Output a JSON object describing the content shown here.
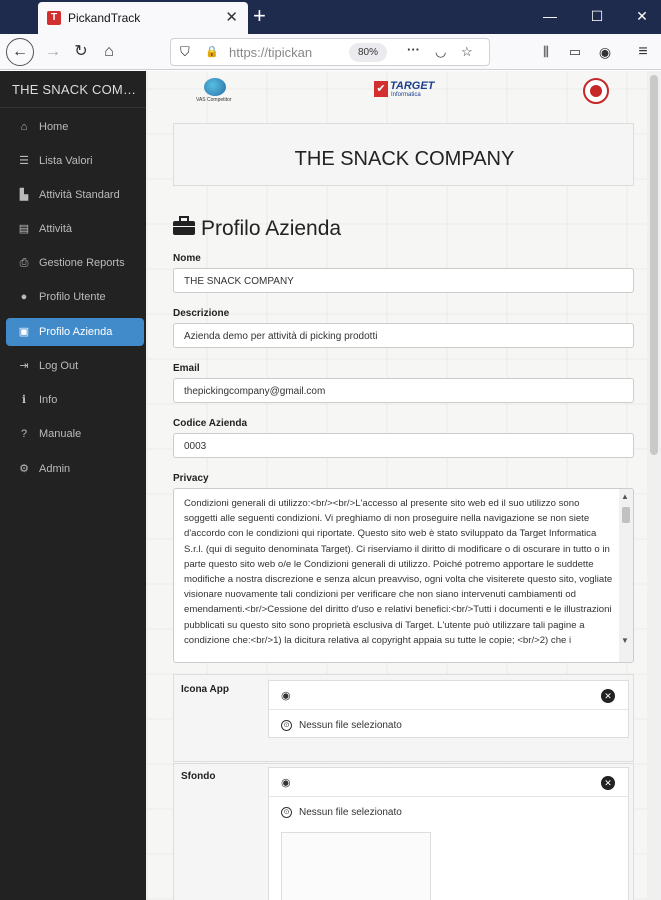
{
  "browser": {
    "tab_title": "PickandTrack",
    "tab_favicon": "T",
    "url": "https://tipickan",
    "zoom": "80%",
    "icons": [
      "back-icon",
      "forward-icon",
      "reload-icon",
      "home-icon",
      "shield-icon",
      "lock-icon",
      "more-icon",
      "pocket-icon",
      "star-icon",
      "library-icon",
      "sidebar-icon",
      "account-icon",
      "menu-icon"
    ]
  },
  "sidebar": {
    "brand": "THE SNACK COMPANY",
    "items": [
      {
        "label": "Home",
        "icon": "home-icon",
        "active": false
      },
      {
        "label": "Lista Valori",
        "icon": "list-icon",
        "active": false
      },
      {
        "label": "Attività Standard",
        "icon": "bar-chart-icon",
        "active": false
      },
      {
        "label": "Attività",
        "icon": "list-alt-icon",
        "active": false
      },
      {
        "label": "Gestione Reports",
        "icon": "print-icon",
        "active": false
      },
      {
        "label": "Profilo Utente",
        "icon": "user-icon",
        "active": false
      },
      {
        "label": "Profilo Azienda",
        "icon": "briefcase-icon",
        "active": true
      },
      {
        "label": "Log Out",
        "icon": "logout-icon",
        "active": false
      },
      {
        "label": "Info",
        "icon": "info-icon",
        "active": false
      },
      {
        "label": "Manuale",
        "icon": "question-icon",
        "active": false
      },
      {
        "label": "Admin",
        "icon": "cog-icon",
        "active": false
      }
    ]
  },
  "header": {
    "company_name": "THE SNACK COMPANY",
    "logo1_caption": "VAS Competitor",
    "logo2_word": "TARGET",
    "logo2_sub": "Informatica"
  },
  "form": {
    "title": "Profilo Azienda",
    "nome_label": "Nome",
    "nome_value": "THE SNACK COMPANY",
    "descrizione_label": "Descrizione",
    "descrizione_value": "Azienda demo per attività di picking prodotti",
    "email_label": "Email",
    "email_value": "thepickingcompany@gmail.com",
    "codice_label": "Codice Azienda",
    "codice_value": "0003",
    "privacy_label": "Privacy",
    "privacy_value": "Condizioni generali di utilizzo:<br/><br/>L'accesso al presente sito web ed il suo utilizzo sono soggetti alle seguenti condizioni. Vi preghiamo di non proseguire nella navigazione se non siete d'accordo con le condizioni qui riportate. Questo sito web è stato sviluppato da Target Informatica S.r.l. (qui di seguito denominata Target). Ci riserviamo il diritto di modificare o di oscurare in tutto o in parte questo sito web o/e le Condizioni generali di utilizzo. Poiché potremo apportare le suddette modifiche a nostra discrezione e senza alcun preavviso, ogni volta che visiterete questo sito, vogliate visionare nuovamente tali condizioni per verificare che non siano intervenuti cambiamenti od emendamenti.<br/>Cessione del diritto d'uso e relativi benefici:<br/>Tutti i documenti e le illustrazioni pubblicati su questo sito sono proprietà esclusiva di Target. L'utente può utilizzare tali pagine a condizione che:<br/>1)    la dicitura relativa al copyright appaia su tutte le copie; <br/>2)        che i",
    "icona_label": "Icona App",
    "sfondo_label": "Sfondo",
    "no_file_text": "Nessun file selezionato"
  }
}
